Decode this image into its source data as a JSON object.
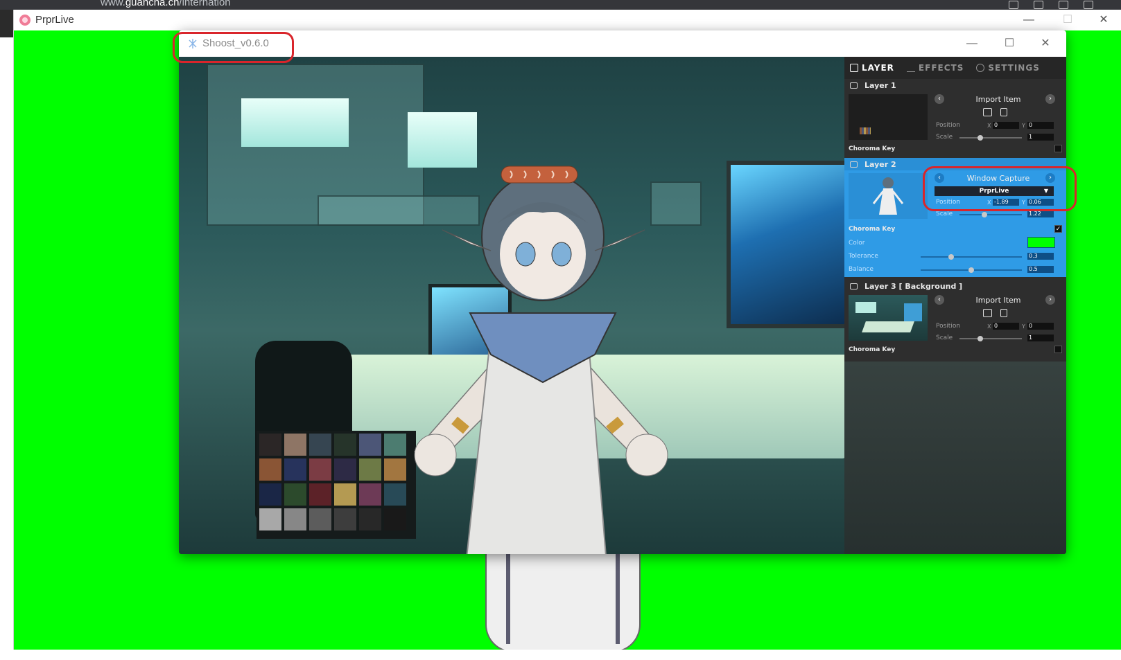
{
  "browser": {
    "url_prefix": "www.",
    "url_domain": "guancha.cn",
    "url_path": "/internation"
  },
  "outer_window": {
    "title": "PrprLive",
    "minimize": "—",
    "maximize": "☐",
    "close": "✕",
    "background_color": "#00ff00"
  },
  "shoost": {
    "title": "Shoost_v0.6.0",
    "minimize": "—",
    "maximize": "☐",
    "close": "✕"
  },
  "panel": {
    "tabs": [
      {
        "label": "LAYER",
        "icon": "layers-icon",
        "active": true
      },
      {
        "label": "EFFECTS",
        "icon": "sliders-icon",
        "active": false
      },
      {
        "label": "SETTINGS",
        "icon": "gear-icon",
        "active": false
      }
    ],
    "layer1": {
      "name": "Layer 1",
      "source": "Import Item",
      "position_label": "Position",
      "x_label": "X",
      "x": "0",
      "y_label": "Y",
      "y": "0",
      "scale_label": "Scale",
      "scale": "1",
      "chroma_label": "Choroma Key",
      "chroma_on": false
    },
    "layer2": {
      "name": "Layer 2",
      "source": "Window Capture",
      "window": "PrprLive",
      "position_label": "Position",
      "x_label": "X",
      "x": "-1.89",
      "y_label": "Y",
      "y": "0.06",
      "scale_label": "Scale",
      "scale": "1.22",
      "chroma_label": "Choroma Key",
      "chroma_on": true,
      "color_label": "Color",
      "chroma_color": "#00ff00",
      "tolerance_label": "Tolerance",
      "tolerance": "0.3",
      "balance_label": "Balance",
      "balance": "0.5"
    },
    "layer3": {
      "name": "Layer 3 [ Background ]",
      "source": "Import Item",
      "position_label": "Position",
      "x_label": "X",
      "x": "0",
      "y_label": "Y",
      "y": "0",
      "scale_label": "Scale",
      "scale": "1",
      "chroma_label": "Choroma Key",
      "chroma_on": false
    }
  }
}
